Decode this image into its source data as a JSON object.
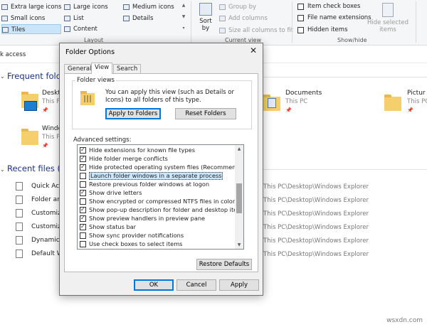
{
  "ribbon": {
    "layout_items": [
      {
        "label": "Extra large icons",
        "selected": false
      },
      {
        "label": "Large icons",
        "selected": false
      },
      {
        "label": "Medium icons",
        "selected": false
      },
      {
        "label": "Small icons",
        "selected": false
      },
      {
        "label": "List",
        "selected": false
      },
      {
        "label": "Details",
        "selected": false
      },
      {
        "label": "Tiles",
        "selected": true
      },
      {
        "label": "Content",
        "selected": false
      }
    ],
    "layout_group_label": "Layout",
    "sort_by_line1": "Sort",
    "sort_by_line2": "by",
    "group_by": "Group by",
    "add_columns": "Add columns",
    "size_all_columns": "Size all columns to fit",
    "current_view_label": "Current view",
    "item_check_boxes": "Item check boxes",
    "file_name_extensions": "File name extensions",
    "hidden_items": "Hidden items",
    "hide_selected_line1": "Hide selected",
    "hide_selected_line2": "items",
    "show_hide_label": "Show/hide"
  },
  "address": "k access",
  "explorer": {
    "frequent_header": "Frequent folde",
    "frequent": [
      {
        "name": "Deskto",
        "sub": "This P"
      },
      {
        "name": "Windo",
        "sub": "This P"
      },
      {
        "name": "Documents",
        "sub": "This PC"
      },
      {
        "name": "Pictur",
        "sub": "This PC"
      }
    ],
    "recent_header": "Recent files (6)",
    "recent": [
      {
        "name": "Quick Acc",
        "path": "This PC\\Desktop\\Windows Explorer"
      },
      {
        "name": "Folder and",
        "path": "This PC\\Desktop\\Windows Explorer"
      },
      {
        "name": "Customize",
        "path": "This PC\\Desktop\\Windows Explorer"
      },
      {
        "name": "Customize",
        "path": "This PC\\Desktop\\Windows Explorer"
      },
      {
        "name": "Dynamic M",
        "path": "This PC\\Desktop\\Windows Explorer"
      },
      {
        "name": "Default W",
        "path": "This PC\\Desktop\\Windows Explorer"
      }
    ]
  },
  "dialog": {
    "title": "Folder Options",
    "close": "✕",
    "tabs": [
      "General",
      "View",
      "Search"
    ],
    "active_tab": "View",
    "folder_views_title": "Folder views",
    "folder_views_text": "You can apply this view (such as Details or Icons) to all folders of this type.",
    "apply_to_folders": "Apply to Folders",
    "reset_folders": "Reset Folders",
    "advanced_label": "Advanced settings:",
    "advanced": [
      {
        "label": "Hide extensions for known file types",
        "checked": true
      },
      {
        "label": "Hide folder merge conflicts",
        "checked": true
      },
      {
        "label": "Hide protected operating system files (Recommended)",
        "checked": true
      },
      {
        "label": "Launch folder windows in a separate process",
        "checked": false,
        "focused": true
      },
      {
        "label": "Restore previous folder windows at logon",
        "checked": false
      },
      {
        "label": "Show drive letters",
        "checked": true
      },
      {
        "label": "Show encrypted or compressed NTFS files in color",
        "checked": false
      },
      {
        "label": "Show pop-up description for folder and desktop items",
        "checked": true
      },
      {
        "label": "Show preview handlers in preview pane",
        "checked": true
      },
      {
        "label": "Show status bar",
        "checked": true
      },
      {
        "label": "Show sync provider notifications",
        "checked": false
      },
      {
        "label": "Use check boxes to select items",
        "checked": false
      }
    ],
    "restore_defaults": "Restore Defaults",
    "ok": "OK",
    "cancel": "Cancel",
    "apply": "Apply"
  },
  "watermark": "wsxdn.com"
}
